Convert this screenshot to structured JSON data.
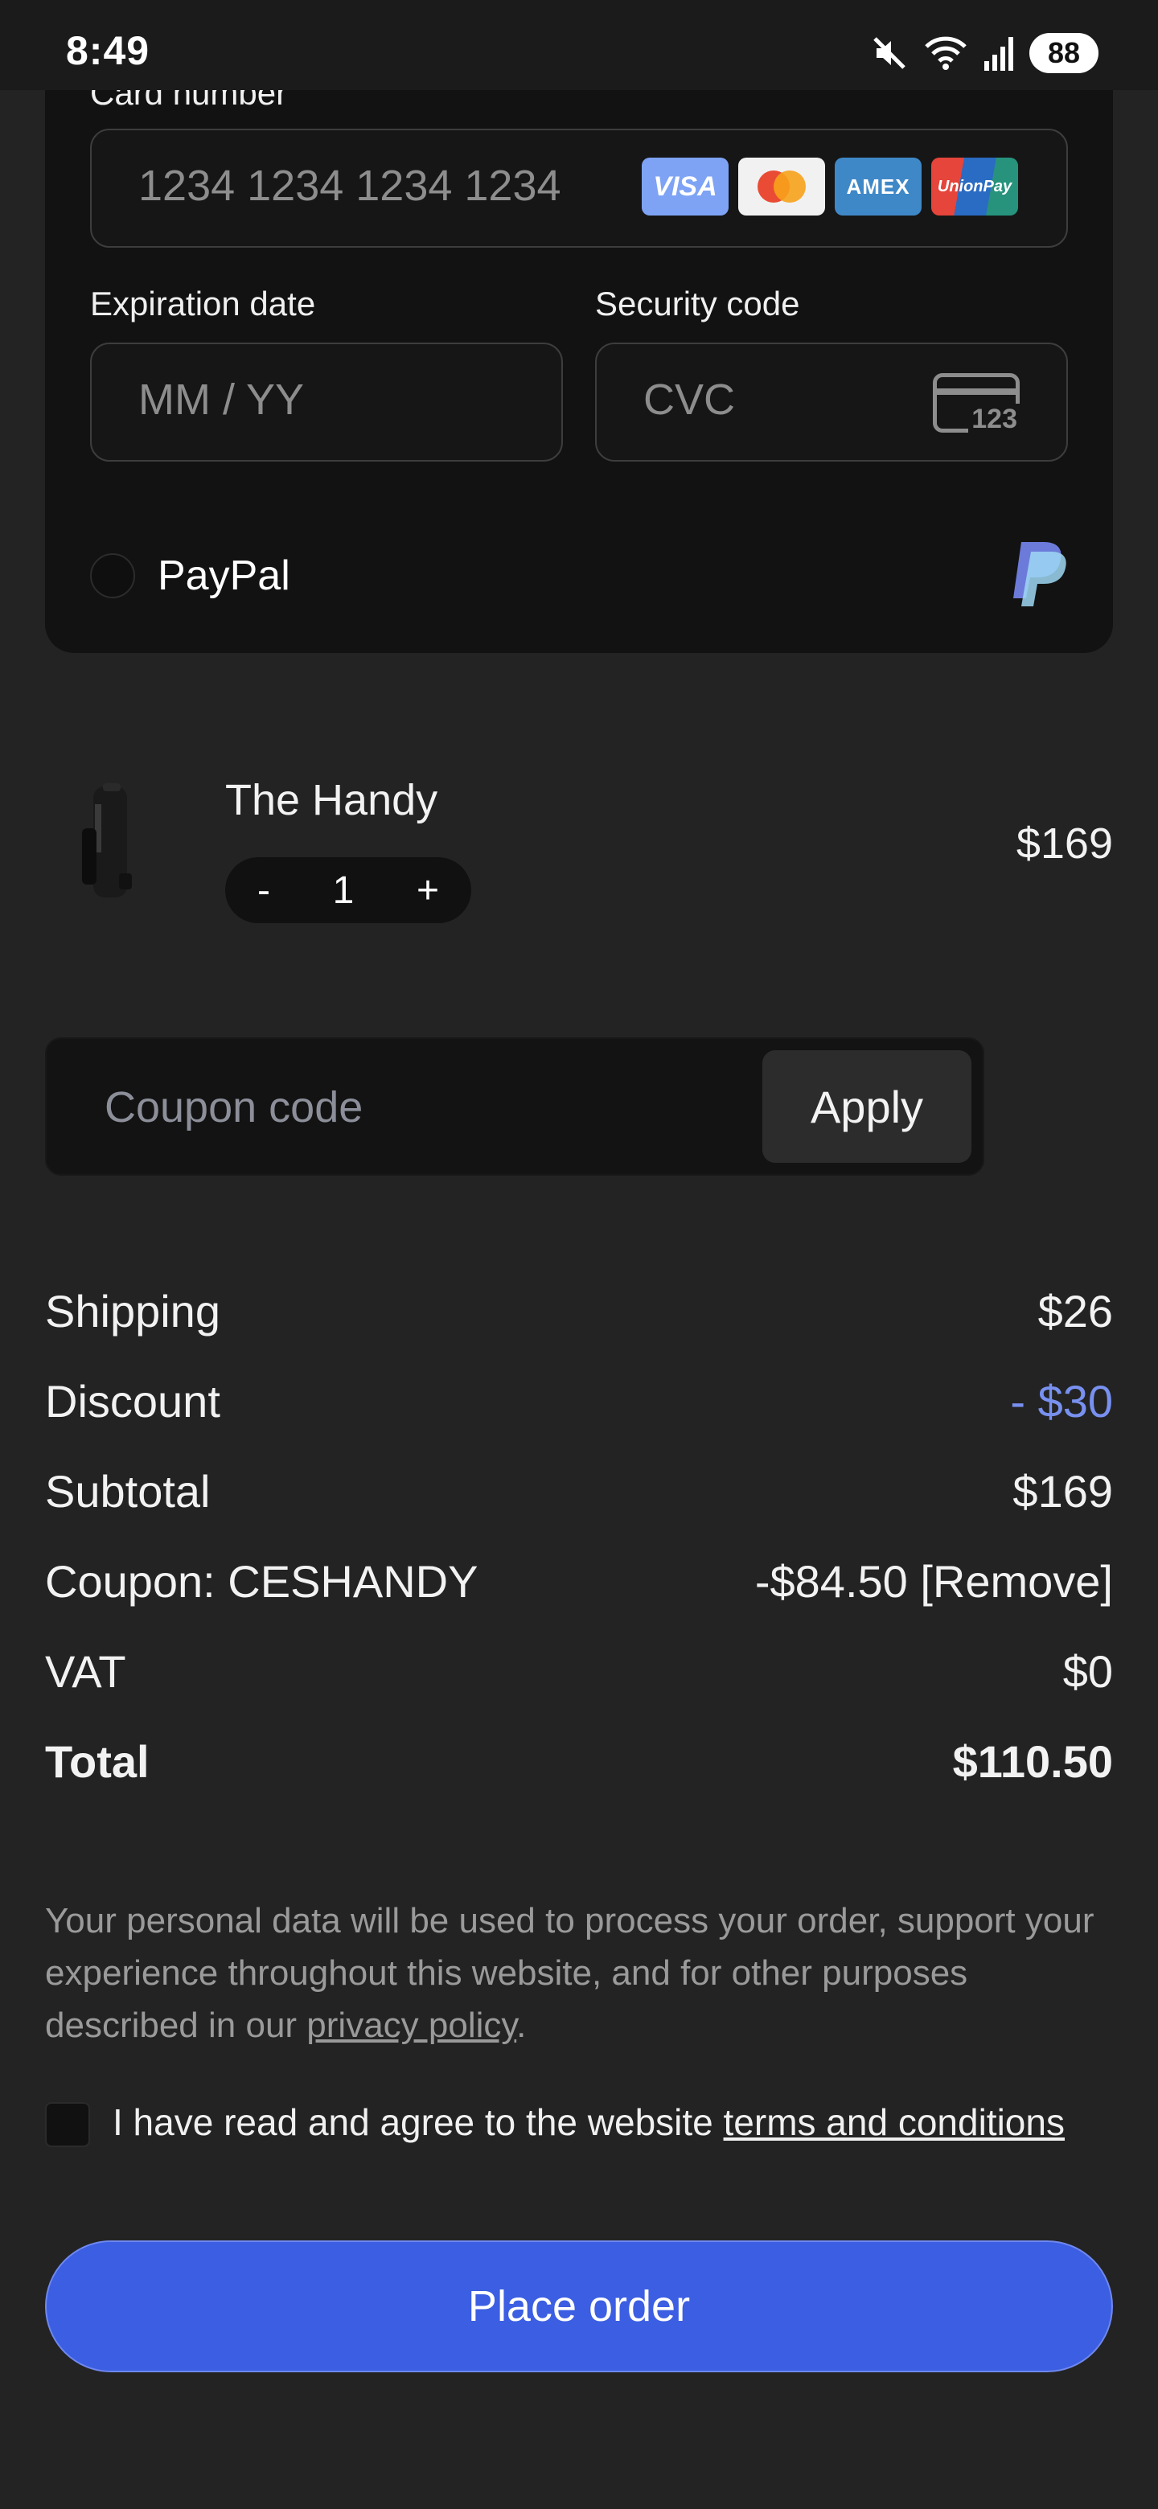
{
  "status_bar": {
    "time": "8:49",
    "battery": "88"
  },
  "payment": {
    "card_number_label": "Card number",
    "card_number_placeholder": "1234 1234 1234 1234",
    "card_brands": [
      "VISA",
      "Mastercard",
      "AMEX",
      "UnionPay"
    ],
    "expiration_label": "Expiration date",
    "expiration_placeholder": "MM / YY",
    "security_label": "Security code",
    "security_placeholder": "CVC",
    "cvc_icon_text": "123",
    "paypal_label": "PayPal"
  },
  "product": {
    "name": "The Handy",
    "quantity": "1",
    "minus": "-",
    "plus": "+",
    "price": "$169"
  },
  "coupon": {
    "placeholder": "Coupon code",
    "apply_label": "Apply"
  },
  "summary": {
    "rows": [
      {
        "label": "Shipping",
        "value": "$26"
      },
      {
        "label": "Discount",
        "value": "- $30"
      },
      {
        "label": "Subtotal",
        "value": "$169"
      },
      {
        "label": "Coupon: CESHANDY",
        "value": "-$84.50 [Remove]"
      },
      {
        "label": "VAT",
        "value": "$0"
      },
      {
        "label": "Total",
        "value": "$110.50"
      }
    ]
  },
  "legal": {
    "privacy_text": "Your personal data will be used to process your order, support your experience throughout this website, and for other purposes described in our ",
    "privacy_link": "privacy policy",
    "privacy_end": ".",
    "terms_text": "I have read and agree to the website ",
    "terms_link": "terms and conditions"
  },
  "place_order_label": "Place order",
  "colors": {
    "accent": "#3b5ee2",
    "discount": "#7891f0",
    "background": "#232323"
  }
}
